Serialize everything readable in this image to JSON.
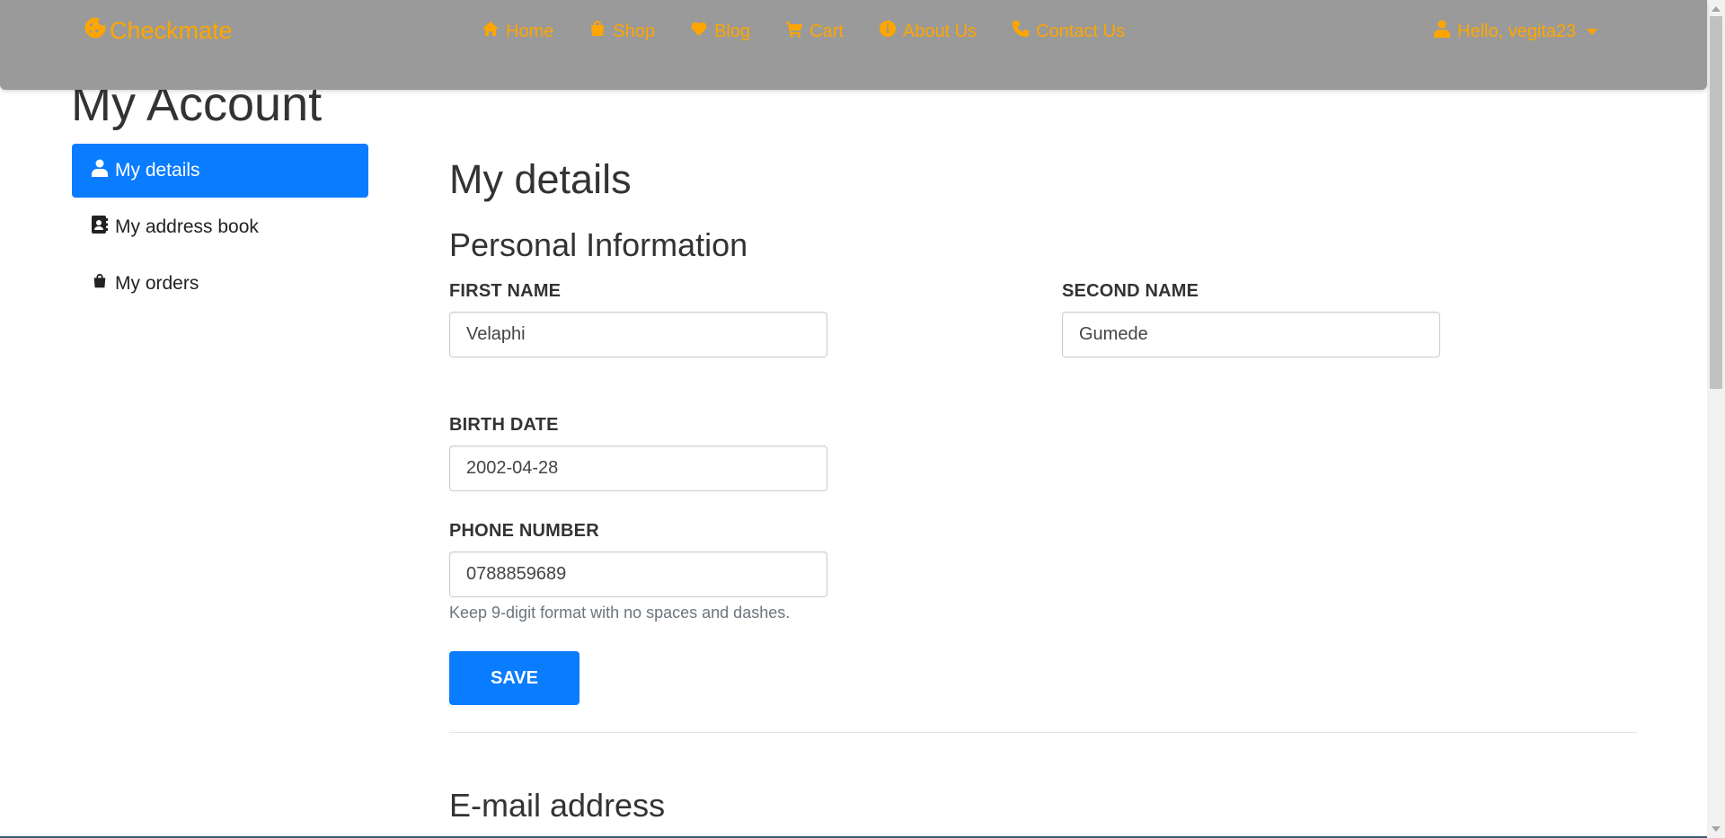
{
  "brand": {
    "name": "Checkmate",
    "icon": "cookie-icon",
    "color": "#ffa500"
  },
  "nav": {
    "items": [
      {
        "label": "Home",
        "icon": "home-icon"
      },
      {
        "label": "Shop",
        "icon": "shopping-bag-icon"
      },
      {
        "label": "Blog",
        "icon": "heart-icon"
      },
      {
        "label": "Cart",
        "icon": "cart-icon"
      },
      {
        "label": "About Us",
        "icon": "info-icon"
      },
      {
        "label": "Contact Us",
        "icon": "phone-icon"
      }
    ],
    "user_greeting": "Hello, vegita23",
    "user_icon": "user-icon",
    "background": "#9a9a9a"
  },
  "page": {
    "title": "My Account"
  },
  "sidebar": {
    "items": [
      {
        "label": "My details",
        "icon": "user-icon",
        "active": true
      },
      {
        "label": "My address book",
        "icon": "address-book-icon",
        "active": false
      },
      {
        "label": "My orders",
        "icon": "shopping-bag-icon",
        "active": false
      }
    ],
    "active_color": "#0a7cff"
  },
  "main": {
    "heading": "My details",
    "section_personal": "Personal Information",
    "fields": {
      "first_name": {
        "label": "First Name",
        "value": "Velaphi"
      },
      "second_name": {
        "label": "Second Name",
        "value": "Gumede"
      },
      "birth_date": {
        "label": "Birth Date",
        "value": "2002-04-28"
      },
      "phone_number": {
        "label": "Phone Number",
        "value": "0788859689",
        "help": "Keep 9-digit format with no spaces and dashes."
      }
    },
    "save_label": "Save",
    "section_email": "E-mail address"
  }
}
